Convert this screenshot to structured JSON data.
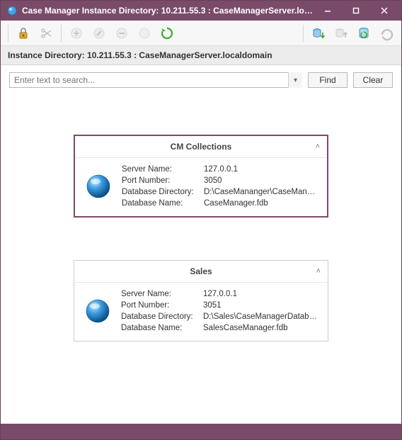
{
  "window": {
    "title": "Case Manager Instance Directory: 10.211.55.3 : CaseManagerServer.loc..."
  },
  "breadcrumb": "Instance Directory: 10.211.55.3 : CaseManagerServer.localdomain",
  "search": {
    "placeholder": "Enter text to search...",
    "find_label": "Find",
    "clear_label": "Clear"
  },
  "labels": {
    "server_name": "Server Name:",
    "port_number": "Port Number:",
    "db_dir": "Database Directory:",
    "db_name": "Database Name:"
  },
  "cards": [
    {
      "title": "CM Collections",
      "selected": true,
      "server_name": "127.0.0.1",
      "port_number": "3050",
      "db_dir": "D:\\CaseMananger\\CaseManagerData…",
      "db_name": "CaseManager.fdb"
    },
    {
      "title": "Sales",
      "selected": false,
      "server_name": "127.0.0.1",
      "port_number": "3051",
      "db_dir": "D:\\Sales\\CaseManagerDatabases\\",
      "db_name": "SalesCaseManager.fdb"
    }
  ]
}
